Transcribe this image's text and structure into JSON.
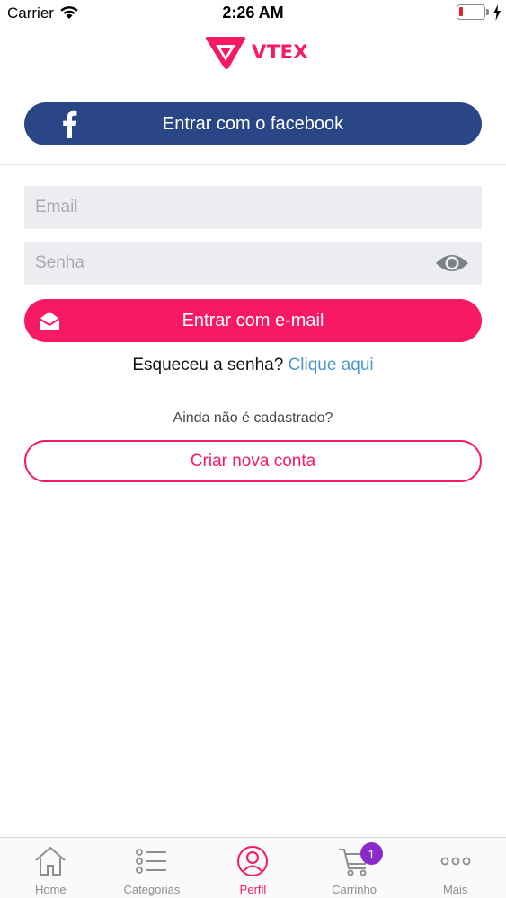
{
  "status_bar": {
    "carrier": "Carrier",
    "time": "2:26 AM",
    "battery_level": 0.15
  },
  "logo": {
    "text": "VTEX",
    "brand_color": "#f71963"
  },
  "login": {
    "facebook_button": "Entrar com o facebook",
    "facebook_icon": "facebook-icon",
    "email_placeholder": "Email",
    "password_placeholder": "Senha",
    "email_button": "Entrar com e-mail",
    "forgot_text": "Esqueceu a senha?",
    "forgot_link": "Clique aqui",
    "not_registered": "Ainda não é cadastrado?",
    "create_account": "Criar nova conta"
  },
  "colors": {
    "facebook": "#2b4687",
    "accent": "#f71963",
    "link": "#4a97c9",
    "badge": "#8b2ac9"
  },
  "tab_bar": {
    "items": [
      {
        "label": "Home",
        "icon": "home-icon",
        "active": false
      },
      {
        "label": "Categorias",
        "icon": "list-icon",
        "active": false
      },
      {
        "label": "Perfil",
        "icon": "profile-icon",
        "active": true
      },
      {
        "label": "Carrinho",
        "icon": "cart-icon",
        "active": false,
        "badge": "1"
      },
      {
        "label": "Mais",
        "icon": "more-icon",
        "active": false
      }
    ]
  }
}
